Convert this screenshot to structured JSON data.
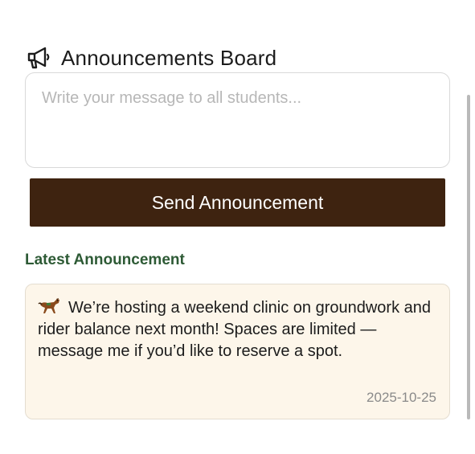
{
  "header": {
    "icon": "megaphone-icon",
    "title": "Announcements Board"
  },
  "composer": {
    "placeholder": "Write your message to all students...",
    "value": "",
    "send_label": "Send Announcement"
  },
  "latest": {
    "heading": "Latest Announcement",
    "icon": "horse-icon",
    "message": "We’re hosting a weekend clinic on groundwork and rider balance next month! Spaces are limited — message me if you’d like to reserve a spot.",
    "date": "2025-10-25"
  },
  "colors": {
    "button_bg": "#3e2310",
    "heading_green": "#2d5a35",
    "card_bg": "#fdf6ea"
  }
}
